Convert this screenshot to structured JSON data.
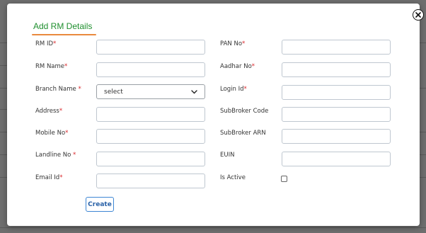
{
  "modal": {
    "title": "Add RM Details",
    "close_icon": "close-icon",
    "accent_color": "#1f8f2e",
    "underline_color": "#e98a3e",
    "required_marker": "*",
    "required_color": "#d9262a"
  },
  "left_fields": [
    {
      "label": "RM ID",
      "required": true,
      "type": "text",
      "value": ""
    },
    {
      "label": "RM Name",
      "required": true,
      "type": "text",
      "value": ""
    },
    {
      "label": "Branch Name ",
      "required": true,
      "type": "select",
      "value": "select"
    },
    {
      "label": "Address",
      "required": true,
      "type": "text",
      "value": ""
    },
    {
      "label": "Mobile No",
      "required": true,
      "type": "text",
      "value": ""
    },
    {
      "label": "Landline No ",
      "required": true,
      "type": "text",
      "value": ""
    },
    {
      "label": "Email Id",
      "required": true,
      "type": "text",
      "value": ""
    }
  ],
  "right_fields": [
    {
      "label": "PAN No",
      "required": true,
      "type": "text",
      "value": ""
    },
    {
      "label": "Aadhar No",
      "required": true,
      "type": "text",
      "value": ""
    },
    {
      "label": "Login Id",
      "required": true,
      "type": "text",
      "value": ""
    },
    {
      "label": "SubBroker Code",
      "required": false,
      "type": "text",
      "value": ""
    },
    {
      "label": "SubBroker ARN",
      "required": false,
      "type": "text",
      "value": ""
    },
    {
      "label": "EUIN",
      "required": false,
      "type": "text",
      "value": ""
    },
    {
      "label": "Is Active",
      "required": false,
      "type": "checkbox",
      "checked": false
    }
  ],
  "actions": {
    "create_label": "Create"
  }
}
